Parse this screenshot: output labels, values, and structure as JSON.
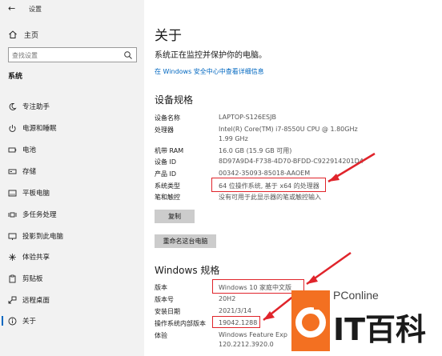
{
  "window": {
    "title": "设置",
    "back_icon": "back-arrow-icon"
  },
  "sidebar": {
    "home_label": "主页",
    "search_placeholder": "查找设置",
    "section_title": "系统",
    "items": [
      {
        "label": "专注助手",
        "icon": "moon-icon"
      },
      {
        "label": "电源和睡眠",
        "icon": "power-icon"
      },
      {
        "label": "电池",
        "icon": "battery-icon"
      },
      {
        "label": "存储",
        "icon": "storage-icon"
      },
      {
        "label": "平板电脑",
        "icon": "tablet-icon"
      },
      {
        "label": "多任务处理",
        "icon": "multitasking-icon"
      },
      {
        "label": "投影到此电脑",
        "icon": "project-icon"
      },
      {
        "label": "体验共享",
        "icon": "share-icon"
      },
      {
        "label": "剪贴板",
        "icon": "clipboard-icon"
      },
      {
        "label": "远程桌面",
        "icon": "remote-desktop-icon"
      },
      {
        "label": "关于",
        "icon": "info-icon",
        "active": true
      }
    ]
  },
  "main": {
    "title": "关于",
    "subtitle": "系统正在监控并保护你的电脑。",
    "security_link": "在 Windows 安全中心中查看详细信息",
    "device_specs": {
      "heading": "设备规格",
      "rows": [
        {
          "key": "设备名称",
          "value": "LAPTOP-S126ESJB"
        },
        {
          "key": "处理器",
          "value": "Intel(R) Core(TM) i7-8550U CPU @ 1.80GHz",
          "value2": "1.99 GHz"
        },
        {
          "key": "机带 RAM",
          "value": "16.0 GB (15.9 GB 可用)"
        },
        {
          "key": "设备 ID",
          "value": "8D97A9D4-F738-4D70-BFDD-C922914201D4"
        },
        {
          "key": "产品 ID",
          "value": "00342-35093-85018-AAOEM"
        },
        {
          "key": "系统类型",
          "value": "64 位操作系统, 基于 x64 的处理器"
        },
        {
          "key": "笔和触控",
          "value": "没有可用于此显示器的笔或触控输入"
        }
      ],
      "copy_button": "复制",
      "rename_button": "重命名这台电脑"
    },
    "windows_specs": {
      "heading": "Windows 规格",
      "rows": [
        {
          "key": "版本",
          "value": "Windows 10 家庭中文版"
        },
        {
          "key": "版本号",
          "value": "20H2"
        },
        {
          "key": "安装日期",
          "value": "2021/3/14"
        },
        {
          "key": "操作系统内部版本",
          "value": "19042.1288"
        },
        {
          "key": "体验",
          "value": "Windows Feature Exp",
          "value2": "120.2212.3920.0"
        }
      ]
    }
  },
  "watermark": {
    "site": "PConline",
    "brand": "IT百科"
  },
  "colors": {
    "accent": "#0067c0",
    "highlight": "#e0242b",
    "sidebar_bg": "#f2f2f2",
    "logo_orange": "#f37021"
  }
}
